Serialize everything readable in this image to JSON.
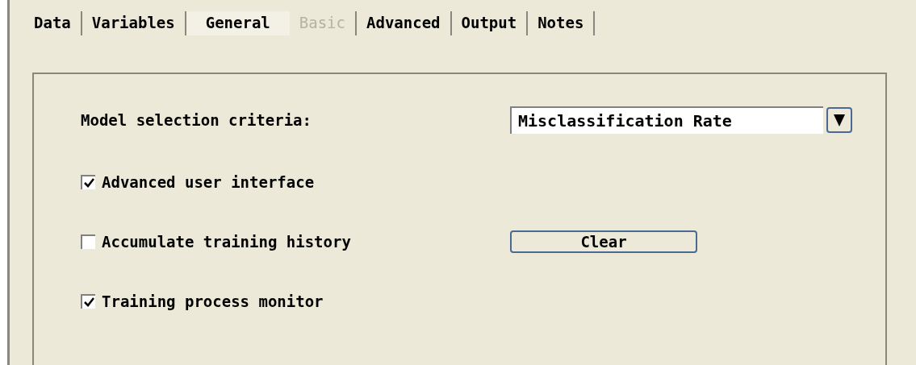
{
  "tabs": [
    {
      "label": "Data",
      "selected": false,
      "disabled": false
    },
    {
      "label": "Variables",
      "selected": false,
      "disabled": false
    },
    {
      "label": "General",
      "selected": true,
      "disabled": false
    },
    {
      "label": "Basic",
      "selected": false,
      "disabled": true
    },
    {
      "label": "Advanced",
      "selected": false,
      "disabled": false
    },
    {
      "label": "Output",
      "selected": false,
      "disabled": false
    },
    {
      "label": "Notes",
      "selected": false,
      "disabled": false
    }
  ],
  "model_selection": {
    "label": "Model selection criteria:",
    "value": "Misclassification Rate"
  },
  "options": [
    {
      "label": "Advanced user interface",
      "checked": true
    },
    {
      "label": "Accumulate training history",
      "checked": false,
      "button": "Clear"
    },
    {
      "label": "Training process monitor",
      "checked": true
    }
  ]
}
